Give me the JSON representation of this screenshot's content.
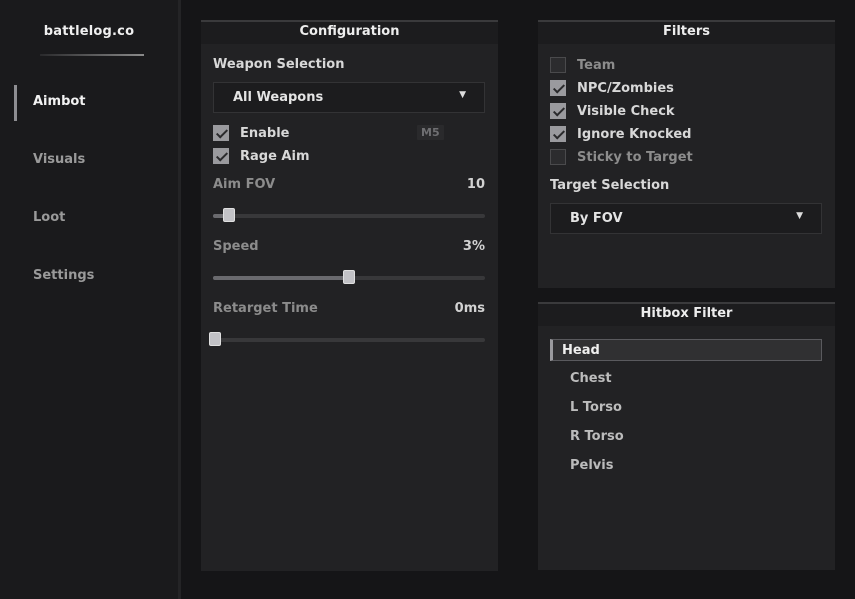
{
  "brand": "battlelog.co",
  "sidebar": {
    "items": [
      {
        "label": "Aimbot",
        "active": true
      },
      {
        "label": "Visuals",
        "active": false
      },
      {
        "label": "Loot",
        "active": false
      },
      {
        "label": "Settings",
        "active": false
      }
    ]
  },
  "configuration": {
    "title": "Configuration",
    "weapon_selection_label": "Weapon Selection",
    "weapon_selection_value": "All Weapons",
    "enable": {
      "label": "Enable",
      "checked": true,
      "key": "M5"
    },
    "rage_aim": {
      "label": "Rage Aim",
      "checked": true
    },
    "aim_fov": {
      "label": "Aim FOV",
      "value": "10",
      "fraction": 0.06
    },
    "speed": {
      "label": "Speed",
      "value": "3%",
      "fraction": 0.5
    },
    "retarget_time": {
      "label": "Retarget Time",
      "value": "0ms",
      "fraction": 0.0
    }
  },
  "filters": {
    "title": "Filters",
    "options": [
      {
        "label": "Team",
        "checked": false
      },
      {
        "label": "NPC/Zombies",
        "checked": true
      },
      {
        "label": "Visible Check",
        "checked": true
      },
      {
        "label": "Ignore Knocked",
        "checked": true
      },
      {
        "label": "Sticky to Target",
        "checked": false
      }
    ],
    "target_selection_label": "Target Selection",
    "target_selection_value": "By FOV"
  },
  "hitbox": {
    "title": "Hitbox Filter",
    "items": [
      {
        "label": "Head",
        "selected": true
      },
      {
        "label": "Chest",
        "selected": false
      },
      {
        "label": "L Torso",
        "selected": false
      },
      {
        "label": "R Torso",
        "selected": false
      },
      {
        "label": "Pelvis",
        "selected": false
      }
    ]
  },
  "icons": {
    "dropdown_caret": "caret-down-icon",
    "checkmark": "check-icon"
  },
  "colors": {
    "background": "#151517",
    "panel": "#222224",
    "accent": "#9a9a9e"
  }
}
